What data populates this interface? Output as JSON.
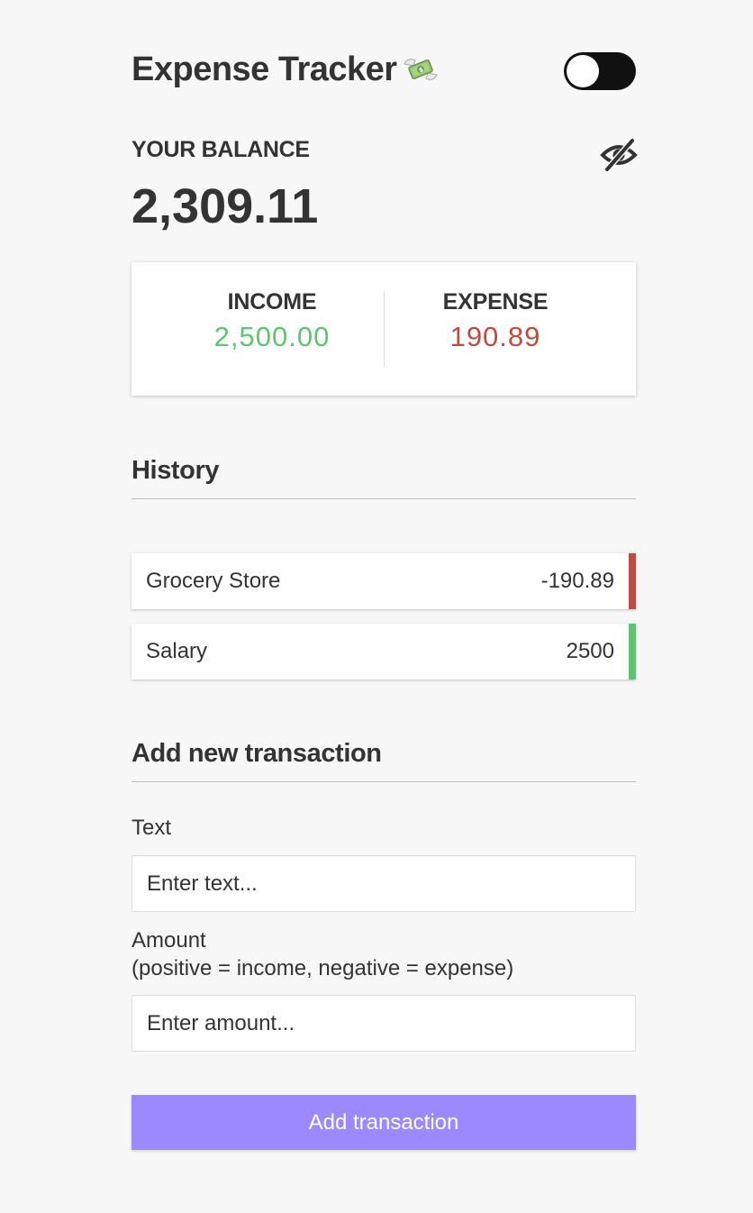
{
  "header": {
    "title": "Expense Tracker",
    "title_icon": "money-with-wings-icon",
    "theme_toggle": {
      "state": "off",
      "icon": "toggle-switch-icon"
    }
  },
  "balance": {
    "label": "YOUR BALANCE",
    "value": "2,309.11",
    "visibility_icon": "eye-slash-icon"
  },
  "summary": {
    "income_label": "INCOME",
    "income_value": "2,500.00",
    "expense_label": "EXPENSE",
    "expense_value": "190.89"
  },
  "history": {
    "title": "History",
    "items": [
      {
        "text": "Grocery Store",
        "amount": "-190.89",
        "kind": "expense"
      },
      {
        "text": "Salary",
        "amount": "2500",
        "kind": "income"
      }
    ]
  },
  "form": {
    "title": "Add new transaction",
    "text_label": "Text",
    "text_placeholder": "Enter text...",
    "amount_label": "Amount",
    "amount_hint": "(positive = income, negative = expense)",
    "amount_placeholder": "Enter amount...",
    "submit_label": "Add transaction"
  },
  "colors": {
    "background": "#f7f7f7",
    "income": "#5fc46f",
    "expense": "#bf4a3f",
    "button": "#9c88ff",
    "text": "#333333"
  }
}
